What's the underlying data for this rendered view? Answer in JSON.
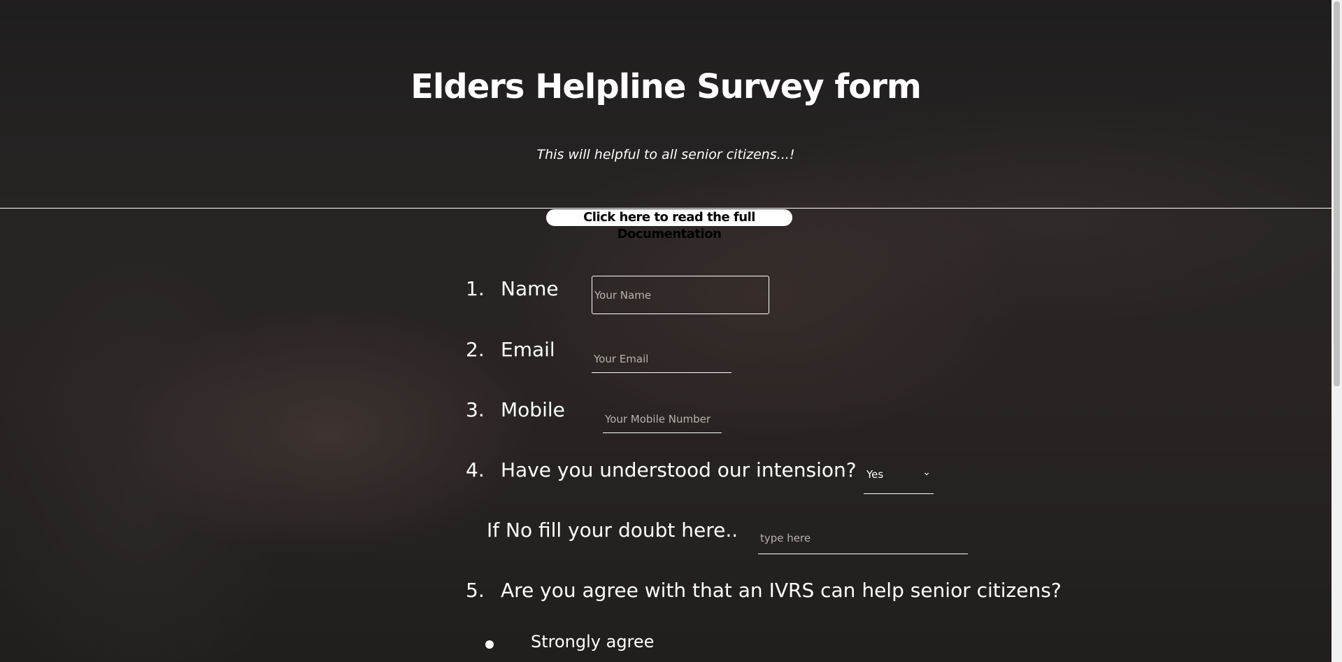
{
  "header": {
    "title": "Elders Helpline Survey form",
    "subtitle": "This will helpful to all senior citizens...!",
    "doc_link": "Click here to read the full Documentation"
  },
  "form": {
    "q1": {
      "number": "1.",
      "label": "Name",
      "placeholder": "Your Name"
    },
    "q2": {
      "number": "2.",
      "label": "Email",
      "placeholder": "Your Email"
    },
    "q3": {
      "number": "3.",
      "label": "Mobile",
      "placeholder": "Your Mobile Number"
    },
    "q4": {
      "number": "4.",
      "label": "Have you understood our intension?",
      "selected": "Yes"
    },
    "doubt": {
      "label": "If No fill your doubt here..",
      "placeholder": "type here"
    },
    "q5": {
      "number": "5.",
      "label": "Are you agree with that an IVRS can help senior citizens?",
      "options": [
        "Strongly agree"
      ]
    }
  },
  "icons": {
    "select_chevron": "chevron-down-icon"
  },
  "colors": {
    "text": "#ffffff",
    "link_bg": "#ffffff",
    "link_text": "#000000"
  }
}
